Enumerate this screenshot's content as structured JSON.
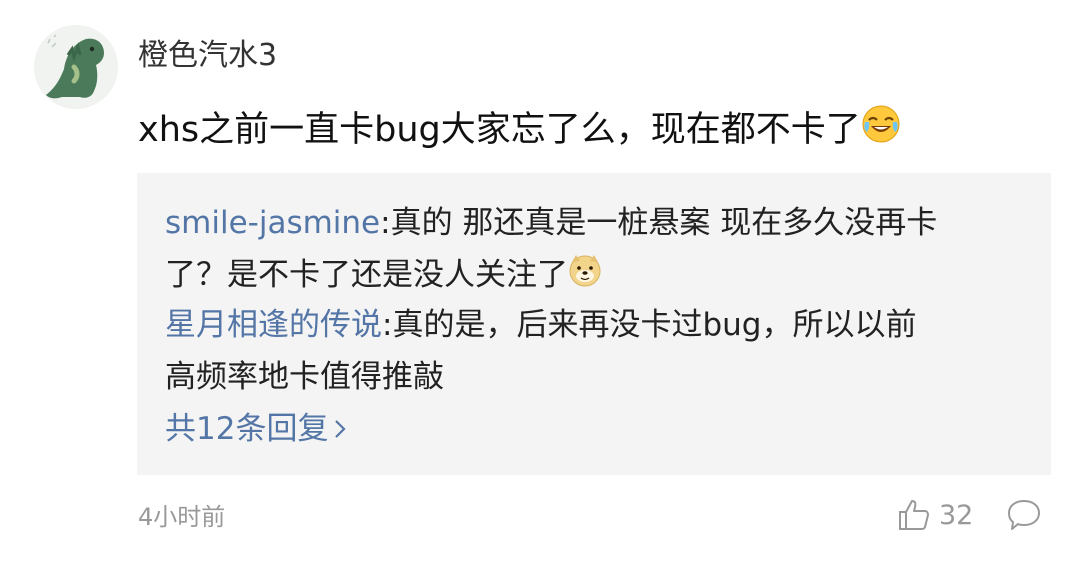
{
  "comment": {
    "author": "橙色汽水3",
    "text": "xhs之前一直卡bug大家忘了么，现在都不卡了",
    "time": "4小时前",
    "likes": "32"
  },
  "replies": [
    {
      "author": "smile-jasmine",
      "sep": ":",
      "line1": "真的 那还真是一桩悬案 现在多久没再卡",
      "line2": "了？是不卡了还是没人关注了"
    },
    {
      "author": "星月相逢的传说",
      "sep": ":",
      "line1": "真的是，后来再没卡过bug，所以以前",
      "line2": "高频率地卡值得推敲"
    }
  ],
  "more_replies": "共12条回复",
  "icons": {
    "avatar": "green-dinosaur-avatar",
    "laugh": "laughing-tears-emoji",
    "doge": "doge-emoji",
    "chevron": "chevron-right-icon",
    "like": "thumbs-up-icon",
    "comment": "comment-bubble-icon"
  }
}
